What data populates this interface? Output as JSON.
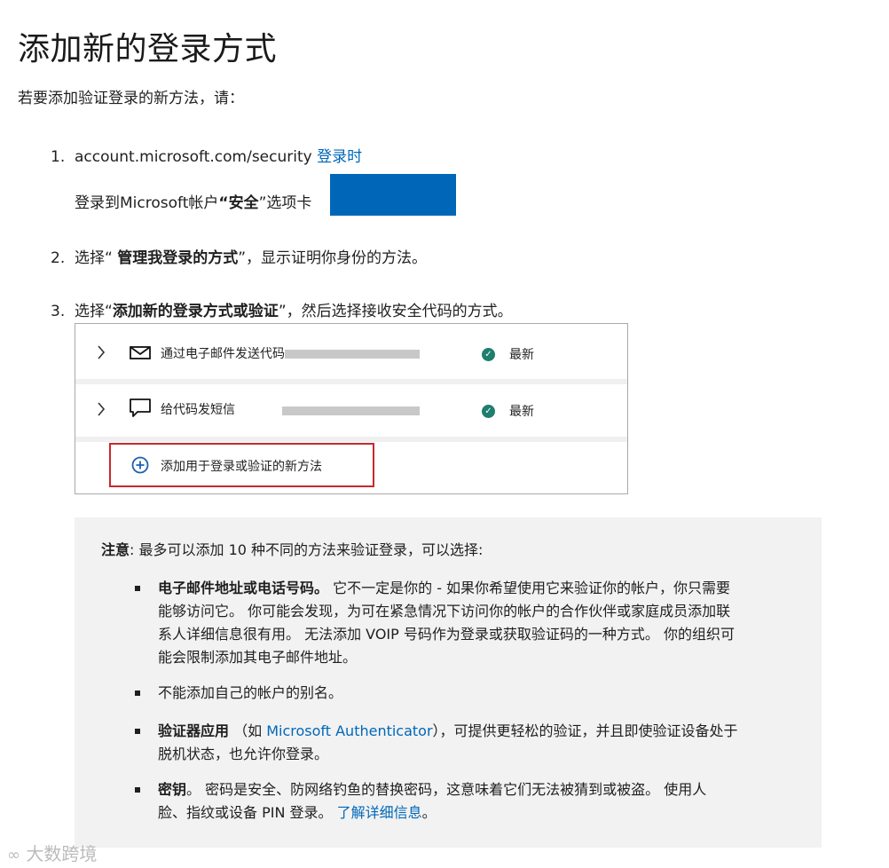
{
  "title": "添加新的登录方式",
  "intro": "若要添加验证登录的新方法，请：",
  "steps": {
    "s1": {
      "number": "1.",
      "url_text": "account.microsoft.com/security",
      "link_text": "登录时",
      "line2_pre": "登录到Microsoft帐户",
      "line2_open_quote": "“",
      "line2_bold": "安全",
      "line2_post": "”选项卡"
    },
    "s2": {
      "number": "2.",
      "pre": "选择“ ",
      "bold": "管理我登录的方式",
      "post": "”，显示证明你身份的方法。"
    },
    "s3": {
      "number": "3.",
      "pre": "选择“",
      "bold": "添加新的登录方式或验证",
      "post": "”，然后选择接收安全代码的方式。"
    }
  },
  "panel": {
    "rows": [
      {
        "label": "通过电子邮件发送代码",
        "icon": "mail-icon",
        "status": "最新"
      },
      {
        "label": "给代码发短信",
        "icon": "chat-icon",
        "status": "最新"
      }
    ],
    "add_label": "添加用于登录或验证的新方法"
  },
  "note": {
    "prefix": "注意",
    "text": ": 最多可以添加 10 种不同的方法来验证登录，可以选择:",
    "items": {
      "email": {
        "bold": "电子邮件地址或电话号码。",
        "l1": " 它不一定是你的 - 如果你希望使用它来验证你的帐户，你只需要",
        "l2": "能够访问它。 你可能会发现，为可在紧急情况下访问你的帐户的合作伙伴或家庭成员添加联",
        "l3": "系人详细信息很有用。 无法添加 VOIP 号码作为登录或获取验证码的一种方式。 你的组织可",
        "l4": "能会限制添加其电子邮件地址。"
      },
      "alias": {
        "text": "不能添加自己的帐户的别名。"
      },
      "authenticator": {
        "bold": "验证器应用",
        "pre": " （如 ",
        "link": "Microsoft Authenticator",
        "post": "），可提供更轻松的验证，并且即使验证设备处于",
        "l2": "脱机状态，也允许你登录。"
      },
      "passkey": {
        "bold": "密钥",
        "l1": "。 密码是安全、防网络钓鱼的替换密码，这意味着它们无法被猜到或被盗。 使用人",
        "l2": "脸、指纹或设备 PIN 登录。 ",
        "link": "了解详细信息",
        "end": "。"
      }
    }
  },
  "watermark": "大数跨境",
  "colors": {
    "link": "#0067b8",
    "blue_block": "#0067b8",
    "check": "#1e7f6e",
    "highlight": "#c8282d",
    "note_bg": "#f2f2f2"
  }
}
